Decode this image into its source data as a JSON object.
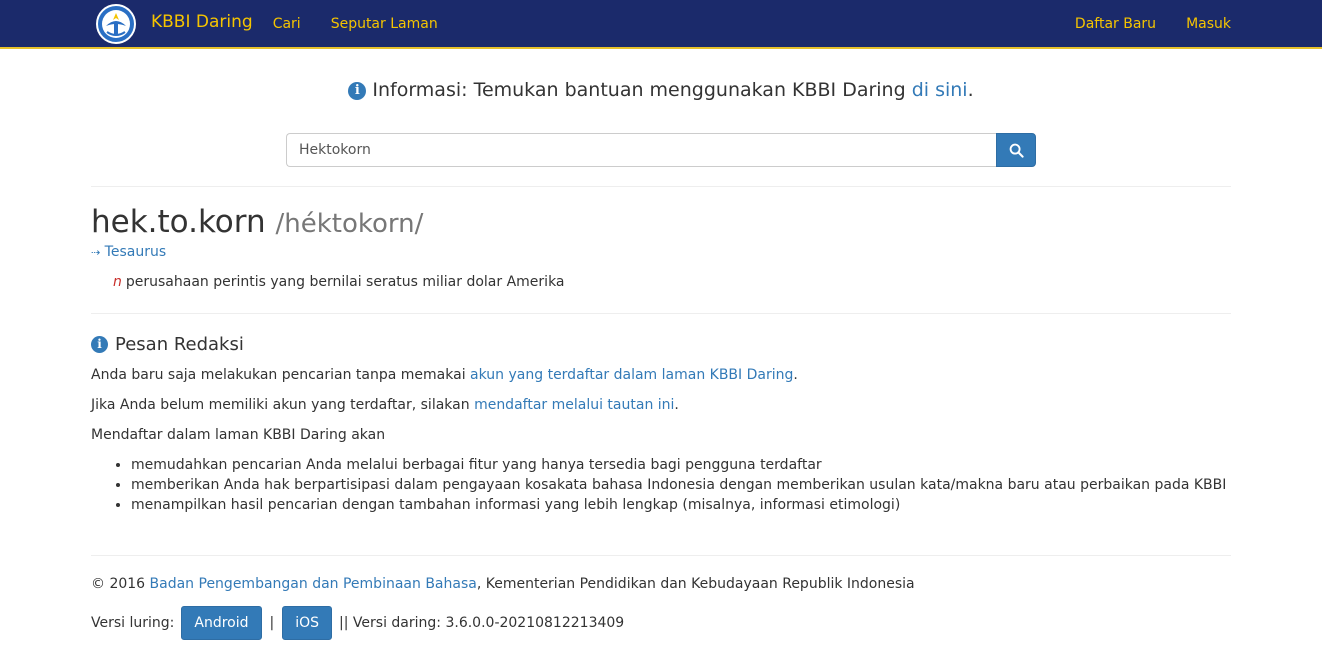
{
  "navbar": {
    "brand": "KBBI Daring",
    "links": {
      "cari": "Cari",
      "seputar": "Seputar Laman"
    },
    "right": {
      "daftar": "Daftar Baru",
      "masuk": "Masuk"
    }
  },
  "info": {
    "text": "Informasi: Temukan bantuan menggunakan KBBI Daring ",
    "link": "di sini",
    "end": "."
  },
  "search": {
    "value": "Hektokorn"
  },
  "entry": {
    "word": "hek.to.korn",
    "pronunciation": "/héktokorn/",
    "thesaurus": "Tesaurus",
    "pos": "n",
    "definition": "perusahaan perintis yang bernilai seratus miliar dolar Amerika"
  },
  "pesan": {
    "title": "Pesan Redaksi",
    "p1_text": "Anda baru saja melakukan pencarian tanpa memakai ",
    "p1_link": "akun yang terdaftar dalam laman KBBI Daring",
    "p1_end": ".",
    "p2_text": "Jika Anda belum memiliki akun yang terdaftar, silakan ",
    "p2_link": "mendaftar melalui tautan ini",
    "p2_end": ".",
    "p3_text": "Mendaftar dalam laman KBBI Daring akan",
    "benefits": [
      "memudahkan pencarian Anda melalui berbagai fitur yang hanya tersedia bagi pengguna terdaftar",
      "memberikan Anda hak berpartisipasi dalam pengayaan kosakata bahasa Indonesia dengan memberikan usulan kata/makna baru atau perbaikan pada KBBI",
      "menampilkan hasil pencarian dengan tambahan informasi yang lebih lengkap (misalnya, informasi etimologi)"
    ]
  },
  "footer": {
    "copy_prefix": "© 2016 ",
    "copy_link": "Badan Pengembangan dan Pembinaan Bahasa",
    "copy_suffix": ", Kementerian Pendidikan dan Kebudayaan Republik Indonesia",
    "versi_luring": "Versi luring:",
    "android": "Android",
    "sep1": "|",
    "ios": "iOS",
    "versi_daring": "|| Versi daring: 3.6.0.0-20210812213409"
  },
  "colors": {
    "navbar_bg": "#1b2a6b",
    "navbar_accent": "#f5c400",
    "link": "#337ab7",
    "primary_button": "#337ab7",
    "pos_label": "#c9302c"
  },
  "icons": {
    "logo": "tut-wuri-handayani-logo",
    "info": "info-circle-icon",
    "search": "search-icon",
    "thesaurus": "dashed-arrow-icon"
  }
}
